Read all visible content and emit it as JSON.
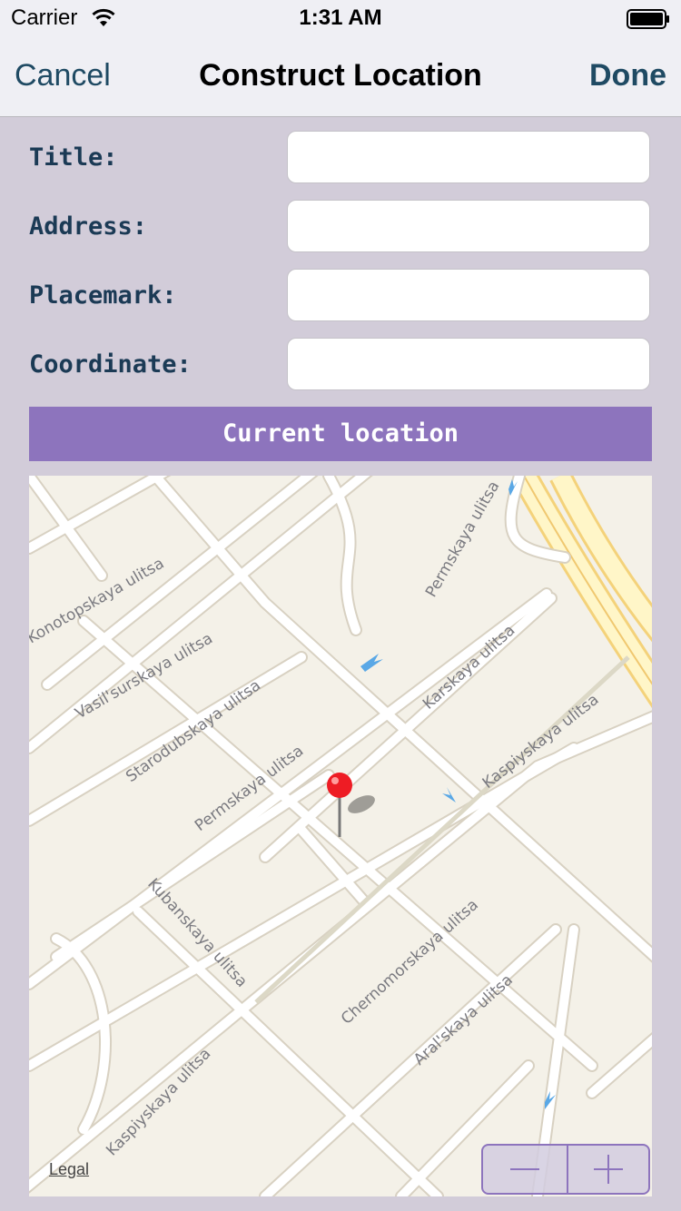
{
  "status_bar": {
    "carrier": "Carrier",
    "time": "1:31 AM"
  },
  "nav": {
    "cancel_label": "Cancel",
    "title": "Construct Location",
    "done_label": "Done"
  },
  "form": {
    "fields": [
      {
        "label": "Title:",
        "value": ""
      },
      {
        "label": "Address:",
        "value": ""
      },
      {
        "label": "Placemark:",
        "value": ""
      },
      {
        "label": "Coordinate:",
        "value": ""
      }
    ]
  },
  "current_location_label": "Current location",
  "map": {
    "streets": [
      "Konotopskaya ulitsa",
      "Vasil'surskaya ulitsa",
      "Starodubskaya ulitsa",
      "Permskaya ulitsa",
      "Permskaya ulitsa",
      "Karskaya ulitsa",
      "Kaspiyskaya ulitsa",
      "Kubanskaya ulitsa",
      "Chernomorskaya ulitsa",
      "Aral'skaya ulitsa",
      "Kaspiyskaya ulitsa"
    ],
    "legal_label": "Legal",
    "pin_color": "#ee1c24"
  },
  "colors": {
    "background": "#d2ccd9",
    "accent": "#8d74bd",
    "nav_text": "#1f4a63",
    "label_text": "#1b3a55"
  }
}
